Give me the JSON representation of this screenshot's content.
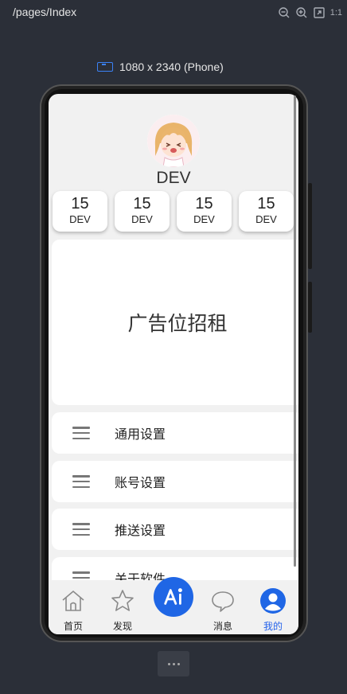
{
  "topbar": {
    "route": "/pages/Index",
    "ratio_label": "1:1"
  },
  "device": {
    "label": "1080 x 2340 (Phone)"
  },
  "profile": {
    "name": "DEV"
  },
  "stats": [
    {
      "value": "15",
      "label": "DEV"
    },
    {
      "value": "15",
      "label": "DEV"
    },
    {
      "value": "15",
      "label": "DEV"
    },
    {
      "value": "15",
      "label": "DEV"
    }
  ],
  "ad": {
    "text": "广告位招租"
  },
  "menu": [
    {
      "label": "通用设置"
    },
    {
      "label": "账号设置"
    },
    {
      "label": "推送设置"
    },
    {
      "label": "关于软件"
    }
  ],
  "tabs": [
    {
      "label": "首页",
      "icon": "home-icon"
    },
    {
      "label": "发现",
      "icon": "star-icon"
    },
    {
      "label": "",
      "icon": "ai-icon"
    },
    {
      "label": "消息",
      "icon": "message-icon"
    },
    {
      "label": "我的",
      "icon": "user-icon"
    }
  ],
  "colors": {
    "accent": "#1f66e5",
    "active_tab": "#2563eb",
    "background": "#2b2f38",
    "screen": "#f1f1f1"
  }
}
